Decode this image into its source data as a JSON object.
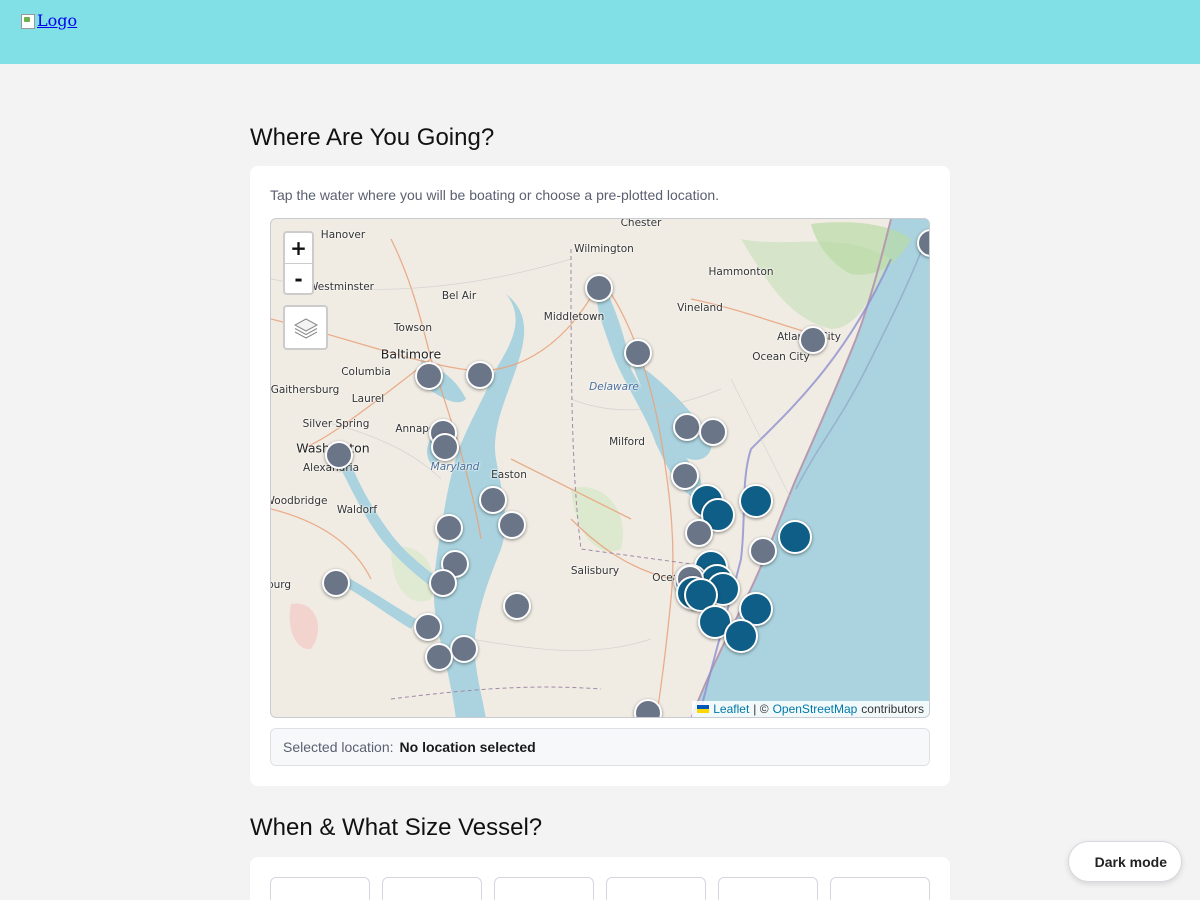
{
  "header": {
    "logo_alt": "Logo"
  },
  "section1": {
    "title": "Where Are You Going?",
    "instructions": "Tap the water where you will be boating or choose a pre-plotted location.",
    "map": {
      "zoom_in": "+",
      "zoom_out": "-",
      "layers_icon": "layers-icon",
      "attribution": {
        "leaflet": "Leaflet",
        "separator": "| ©",
        "osm": "OpenStreetMap",
        "contributors": "contributors"
      },
      "place_labels": [
        "Chester",
        "Hanover",
        "Wilmington",
        "Hammonton",
        "Westminster",
        "Bel Air",
        "Vineland",
        "Towson",
        "Middletown",
        "Atlantic City",
        "Ocean City",
        "Baltimore",
        "Columbia",
        "Delaware",
        "Gaithersburg",
        "Laurel",
        "Silver Spring",
        "Annapolis",
        "Milford",
        "Washington",
        "Alexandria",
        "Maryland",
        "Easton",
        "Woodbridge",
        "Waldorf",
        "Salisbury",
        "Ocean City",
        "burg"
      ]
    },
    "selected_label": "Selected location:",
    "selected_value": "No location selected"
  },
  "section2": {
    "title": "When & What Size Vessel?"
  },
  "dark_mode_label": "Dark mode",
  "colors": {
    "header": "#80e0e6",
    "marker_gray": "#6b7588",
    "marker_blue": "#0f5e87",
    "water": "#aad3df"
  }
}
